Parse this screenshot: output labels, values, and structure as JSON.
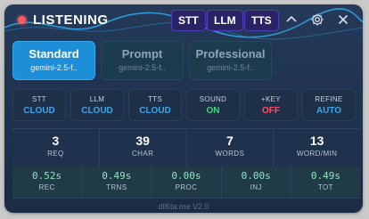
{
  "header": {
    "title": "LISTENING",
    "chips": [
      "STT",
      "LLM",
      "TTS"
    ],
    "icons": [
      "chevron-up-icon",
      "gear-icon",
      "close-icon"
    ]
  },
  "modes": [
    {
      "name": "Standard",
      "model": "gemini-2.5-f..",
      "active": true
    },
    {
      "name": "Prompt",
      "model": "gemini-2.5-f..",
      "active": false
    },
    {
      "name": "Professional",
      "model": "gemini-2.5-f..",
      "active": false
    }
  ],
  "switches": [
    {
      "label": "STT",
      "value": "CLOUD",
      "color": "#3ea6e8"
    },
    {
      "label": "LLM",
      "value": "CLOUD",
      "color": "#3ea6e8"
    },
    {
      "label": "TTS",
      "value": "CLOUD",
      "color": "#3ea6e8"
    },
    {
      "label": "SOUND",
      "value": "ON",
      "color": "#3fd67a"
    },
    {
      "label": "+KEY",
      "value": "OFF",
      "color": "#ff4d5e"
    },
    {
      "label": "REFINE",
      "value": "AUTO",
      "color": "#3ea6e8"
    }
  ],
  "stats": [
    {
      "value": "3",
      "label": "REQ"
    },
    {
      "value": "39",
      "label": "CHAR"
    },
    {
      "value": "7",
      "label": "WORDS"
    },
    {
      "value": "13",
      "label": "WORD/MIN"
    }
  ],
  "timings": [
    {
      "value": "0.52s",
      "label": "REC"
    },
    {
      "value": "0.49s",
      "label": "TRNS"
    },
    {
      "value": "0.00s",
      "label": "PROC"
    },
    {
      "value": "0.00s",
      "label": "INJ"
    },
    {
      "value": "0.49s",
      "label": "TOT"
    }
  ],
  "footer": "dIKta.me V2.0",
  "colors": {
    "accent": "#1d8fd9",
    "recording": "#ff5a5a"
  }
}
